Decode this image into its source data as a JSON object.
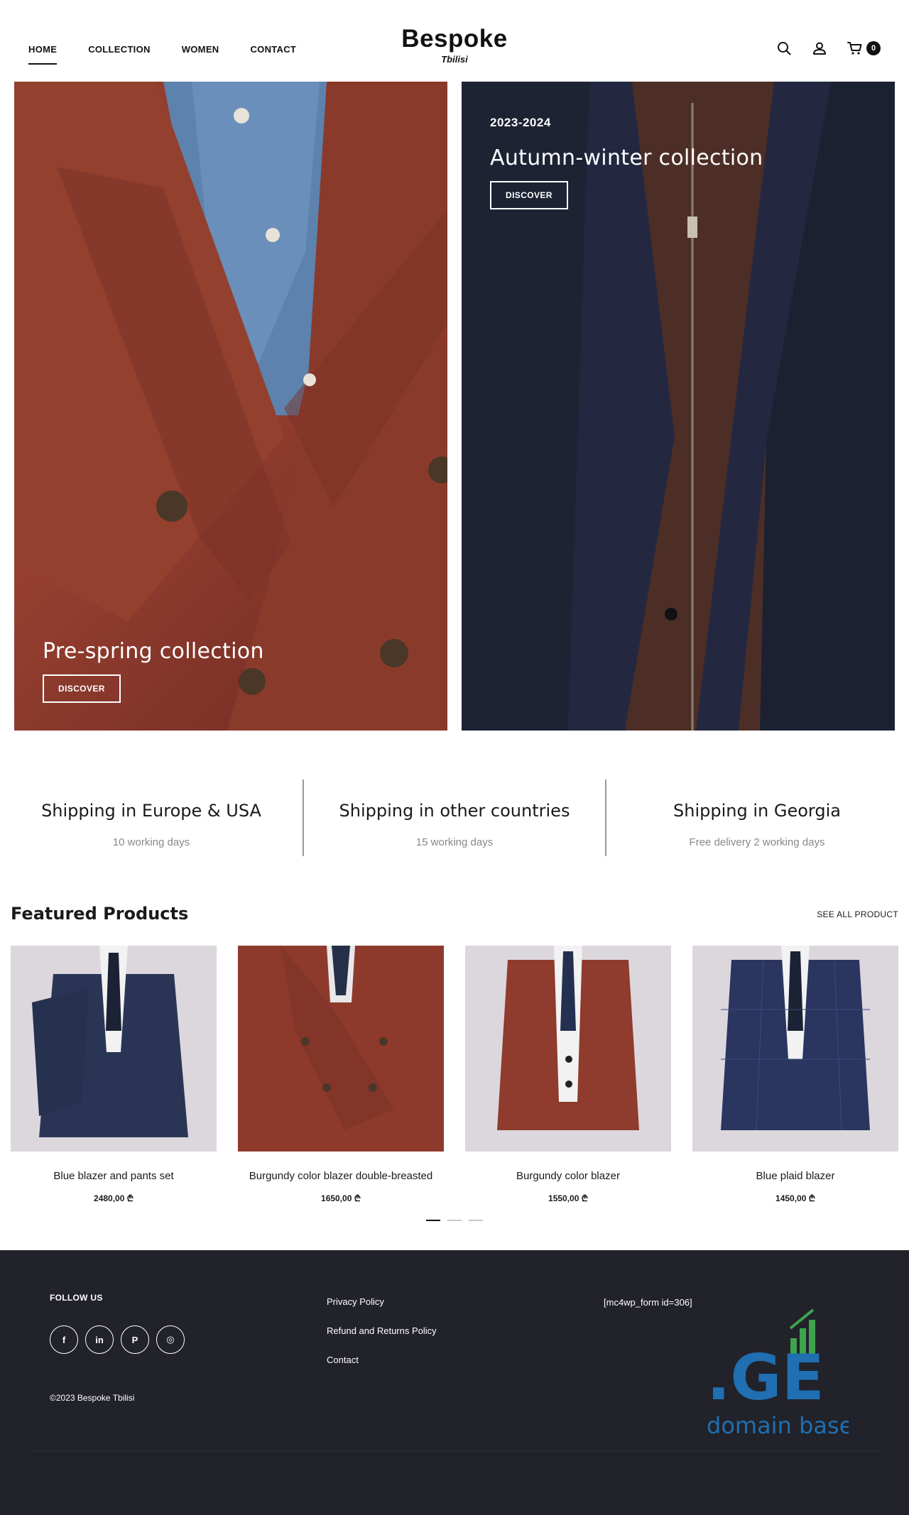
{
  "header": {
    "nav": [
      "HOME",
      "COLLECTION",
      "WOMEN",
      "CONTACT"
    ],
    "logo_main": "Bespoke",
    "logo_sub": "Tbilisi",
    "cart_count": "0",
    "icons": [
      "search-icon",
      "user-icon",
      "cart-icon"
    ]
  },
  "hero": {
    "left": {
      "title": "Pre-spring collection",
      "button": "DISCOVER"
    },
    "right": {
      "kicker": "2023-2024",
      "title": "Autumn-winter collection",
      "button": "DISCOVER"
    }
  },
  "shipping": [
    {
      "title": "Shipping in Europe & USA",
      "sub": "10 working days"
    },
    {
      "title": "Shipping in other countries",
      "sub": "15 working days"
    },
    {
      "title": "Shipping in Georgia",
      "sub": "Free delivery 2 working days"
    }
  ],
  "featured": {
    "title": "Featured Products",
    "see_all": "SEE ALL PRODUCT",
    "products": [
      {
        "name": "Blue blazer and pants set",
        "price": "2480,00 ₾"
      },
      {
        "name": "Burgundy color blazer double-breasted",
        "price": "1650,00 ₾"
      },
      {
        "name": "Burgundy color blazer",
        "price": "1550,00 ₾"
      },
      {
        "name": "Blue plaid blazer",
        "price": "1450,00 ₾"
      }
    ],
    "pager_active": 1,
    "pager_total": 3
  },
  "footer": {
    "follow": "FOLLOW US",
    "socials": [
      "f",
      "in",
      "P",
      "◎"
    ],
    "social_icons": [
      "facebook-icon",
      "linkedin-icon",
      "pinterest-icon",
      "instagram-icon"
    ],
    "copyright": "©2023 Bespoke Tbilisi",
    "links": [
      "Privacy Policy",
      "Refund and Returns Policy",
      "Contact"
    ],
    "form_shortcode": "[mc4wp_form id=306]",
    "brand_main": ".GE",
    "brand_sub": "domain base"
  },
  "colors": {
    "footer_bg": "#21222a",
    "brand_blue": "#1f6fb2",
    "brand_green": "#3fa34d"
  }
}
